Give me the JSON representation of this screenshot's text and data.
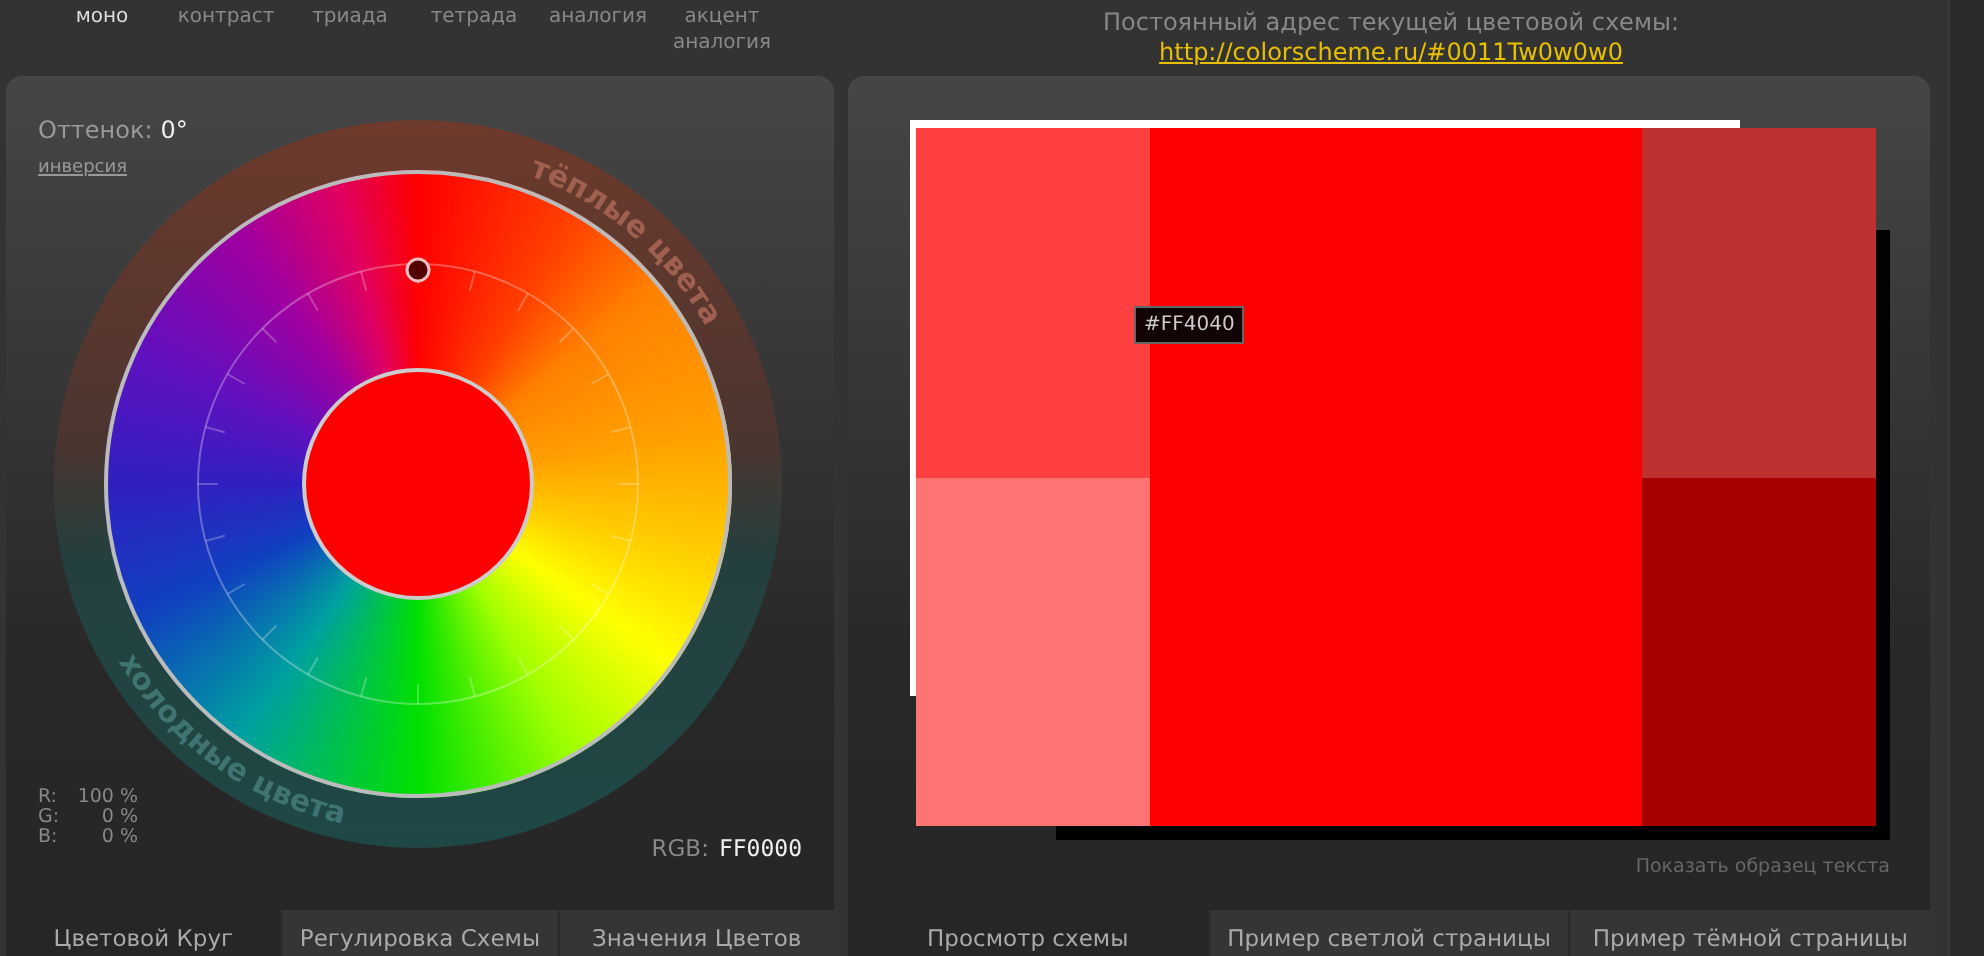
{
  "modes": [
    {
      "label": "моно",
      "selected": true
    },
    {
      "label": "контраст",
      "selected": false
    },
    {
      "label": "триада",
      "selected": false
    },
    {
      "label": "тетрада",
      "selected": false
    },
    {
      "label": "аналогия",
      "selected": false
    },
    {
      "label": "акцент аналогия",
      "selected": false
    }
  ],
  "scheme_url": {
    "caption": "Постоянный адрес текущей цветовой схемы:",
    "link": "http://colorscheme.ru/#0011Tw0w0w0"
  },
  "wheel_panel": {
    "hue_label": "Оттенок:",
    "hue_value": "0°",
    "invert_link": "инверсия",
    "warm_label": "тёплые цвета",
    "cold_label": "холодные цвета",
    "rgb_percent": [
      {
        "channel": "R:",
        "value": "100 %"
      },
      {
        "channel": "G:",
        "value": "0 %"
      },
      {
        "channel": "B:",
        "value": "0 %"
      }
    ],
    "rgb_label": "RGB:",
    "rgb_value": "FF0000"
  },
  "left_tabs": [
    {
      "label": "Цветовой Круг",
      "selected": true
    },
    {
      "label": "Регулировка Схемы",
      "selected": false
    },
    {
      "label": "Значения Цветов",
      "selected": false
    }
  ],
  "preview": {
    "swatches": [
      {
        "kind": "side",
        "color": "#ff4040"
      },
      {
        "kind": "side",
        "color": "#ff7373"
      },
      {
        "kind": "main",
        "color": "#ff0000"
      },
      {
        "kind": "side",
        "color": "#bf3030"
      },
      {
        "kind": "side",
        "color": "#a60000"
      }
    ],
    "tooltip": "#FF4040",
    "sample_text_link": "Показать образец текста"
  },
  "right_tabs": [
    {
      "label": "Просмотр схемы",
      "selected": true
    },
    {
      "label": "Пример светлой страницы",
      "selected": false
    },
    {
      "label": "Пример тёмной страницы",
      "selected": false
    }
  ]
}
